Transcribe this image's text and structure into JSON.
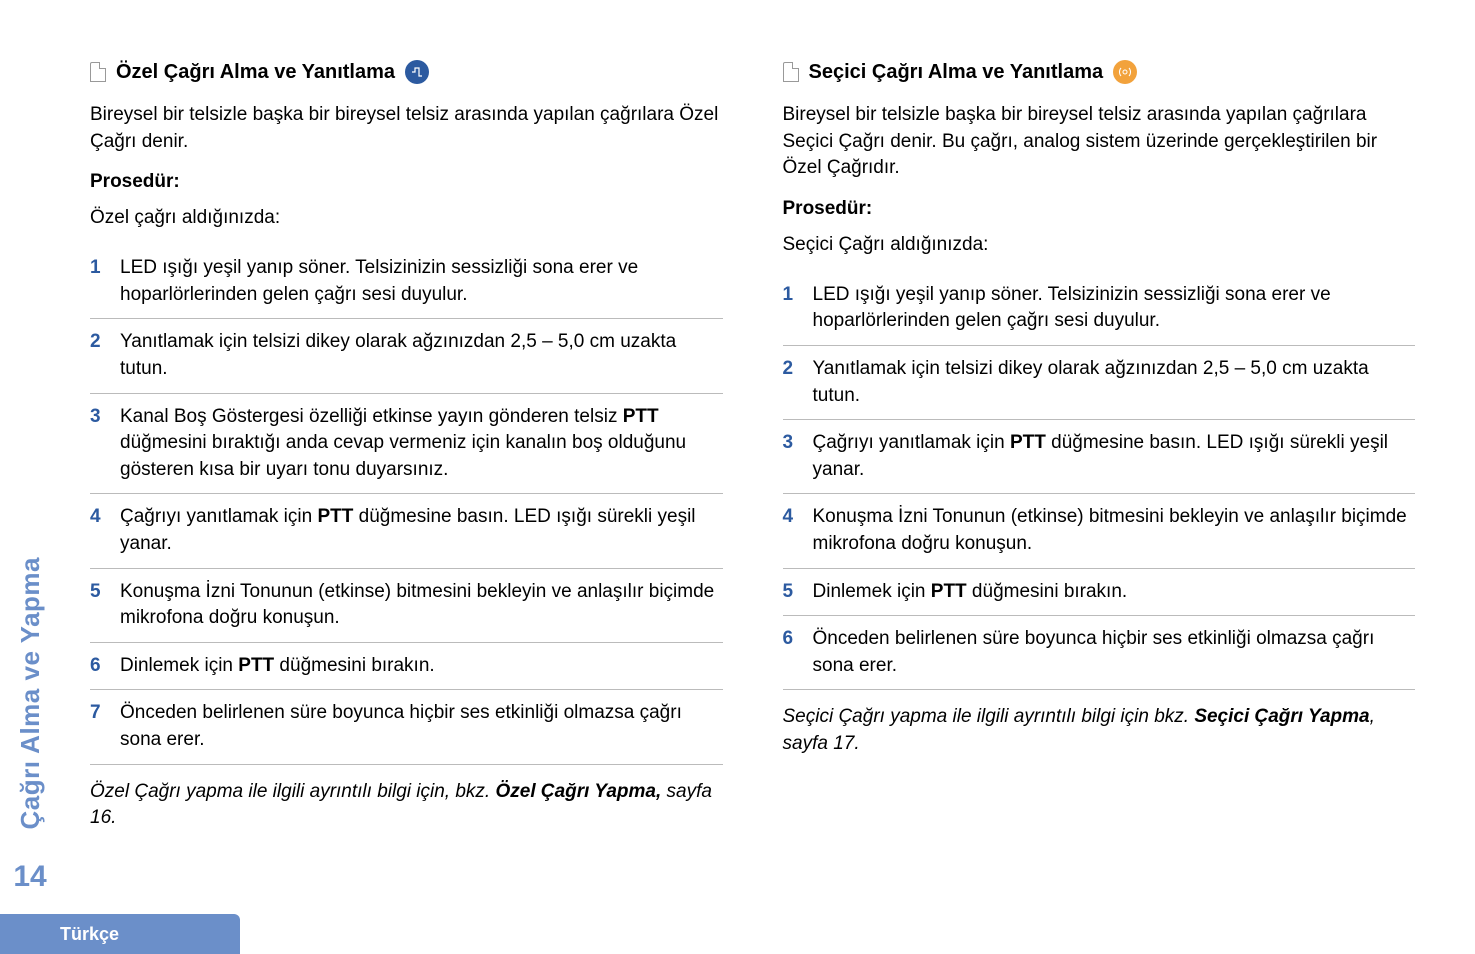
{
  "side": {
    "vertical": "Çağrı Alma ve Yapma",
    "page_number": "14"
  },
  "footer": {
    "lang": "Türkçe"
  },
  "left": {
    "heading": "Özel Çağrı Alma ve Yanıtlama",
    "intro": "Bireysel bir telsizle başka bir bireysel telsiz arasında yapılan çağrılara Özel Çağrı denir.",
    "procedure_label": "Prosedür:",
    "when_text": "Özel çağrı aldığınızda:",
    "steps": [
      {
        "n": "1",
        "text": "LED ışığı yeşil yanıp söner. Telsizinizin sessizliği sona erer ve hoparlörlerinden gelen çağrı sesi duyulur."
      },
      {
        "n": "2",
        "text": "Yanıtlamak için telsizi dikey olarak ağzınızdan 2,5 – 5,0 cm uzakta tutun."
      },
      {
        "n": "3",
        "pre": "Kanal Boş Göstergesi özelliği etkinse yayın gönderen telsiz ",
        "bold": "PTT",
        "post": " düğmesini bıraktığı anda cevap vermeniz için kanalın boş olduğunu gösteren kısa bir uyarı tonu duyarsınız."
      },
      {
        "n": "4",
        "pre": "Çağrıyı yanıtlamak için ",
        "bold": "PTT",
        "post": " düğmesine basın. LED ışığı sürekli yeşil yanar."
      },
      {
        "n": "5",
        "text": "Konuşma İzni Tonunun (etkinse) bitmesini bekleyin ve anlaşılır biçimde mikrofona doğru konuşun."
      },
      {
        "n": "6",
        "pre": "Dinlemek için ",
        "bold": "PTT",
        "post": " düğmesini bırakın."
      },
      {
        "n": "7",
        "text": "Önceden belirlenen süre boyunca hiçbir ses etkinliği olmazsa çağrı sona erer."
      }
    ],
    "note_pre": "Özel Çağrı yapma ile ilgili ayrıntılı bilgi için, bkz. ",
    "note_bold": "Özel Çağrı Yapma,",
    "note_post": " sayfa 16."
  },
  "right": {
    "heading": "Seçici Çağrı Alma ve Yanıtlama",
    "intro": "Bireysel bir telsizle başka bir bireysel telsiz arasında yapılan çağrılara Seçici Çağrı denir. Bu çağrı, analog sistem üzerinde gerçekleştirilen bir Özel Çağrıdır.",
    "procedure_label": "Prosedür:",
    "when_text": "Seçici Çağrı aldığınızda:",
    "steps": [
      {
        "n": "1",
        "text": "LED ışığı yeşil yanıp söner. Telsizinizin sessizliği sona erer ve hoparlörlerinden gelen çağrı sesi duyulur."
      },
      {
        "n": "2",
        "text": "Yanıtlamak için telsizi dikey olarak ağzınızdan 2,5 – 5,0 cm uzakta tutun."
      },
      {
        "n": "3",
        "pre": "Çağrıyı yanıtlamak için ",
        "bold": "PTT",
        "post": " düğmesine basın. LED ışığı sürekli yeşil yanar."
      },
      {
        "n": "4",
        "text": "Konuşma İzni Tonunun (etkinse) bitmesini bekleyin ve anlaşılır biçimde mikrofona doğru konuşun."
      },
      {
        "n": "5",
        "pre": "Dinlemek için ",
        "bold": "PTT",
        "post": " düğmesini bırakın."
      },
      {
        "n": "6",
        "text": "Önceden belirlenen süre boyunca hiçbir ses etkinliği olmazsa çağrı sona erer."
      }
    ],
    "note_pre": "Seçici Çağrı yapma ile ilgili ayrıntılı bilgi için bkz. ",
    "note_bold": "Seçici Çağrı Yapma",
    "note_post": ", sayfa 17."
  }
}
